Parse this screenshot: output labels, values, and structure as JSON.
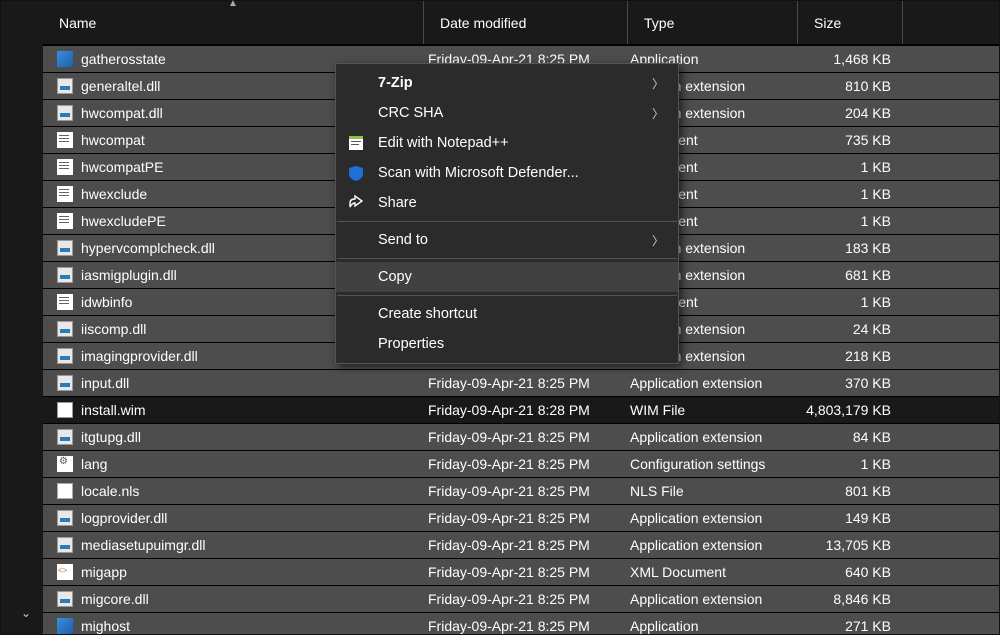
{
  "columns": {
    "name": "Name",
    "date": "Date modified",
    "type": "Type",
    "size": "Size"
  },
  "files": [
    {
      "icon": "app",
      "name": "gatherosstate",
      "date": "Friday-09-Apr-21 8:25 PM",
      "type": "Application",
      "size": "1,468 KB",
      "sel": true
    },
    {
      "icon": "dll",
      "name": "generaltel.dll",
      "date": "",
      "type": "…cation extension",
      "size": "810 KB",
      "sel": true
    },
    {
      "icon": "dll",
      "name": "hwcompat.dll",
      "date": "",
      "type": "…cation extension",
      "size": "204 KB",
      "sel": true
    },
    {
      "icon": "txt",
      "name": "hwcompat",
      "date": "",
      "type": "…ocument",
      "size": "735 KB",
      "sel": true
    },
    {
      "icon": "txt",
      "name": "hwcompatPE",
      "date": "",
      "type": "…ocument",
      "size": "1 KB",
      "sel": true
    },
    {
      "icon": "txt",
      "name": "hwexclude",
      "date": "",
      "type": "…ocument",
      "size": "1 KB",
      "sel": true
    },
    {
      "icon": "txt",
      "name": "hwexcludePE",
      "date": "",
      "type": "…ocument",
      "size": "1 KB",
      "sel": true
    },
    {
      "icon": "dll",
      "name": "hypervcomplcheck.dll",
      "date": "",
      "type": "…cation extension",
      "size": "183 KB",
      "sel": true
    },
    {
      "icon": "dll",
      "name": "iasmigplugin.dll",
      "date": "",
      "type": "…cation extension",
      "size": "681 KB",
      "sel": true
    },
    {
      "icon": "txt",
      "name": "idwbinfo",
      "date": "",
      "type": "…ocument",
      "size": "1 KB",
      "sel": true
    },
    {
      "icon": "dll",
      "name": "iiscomp.dll",
      "date": "",
      "type": "…cation extension",
      "size": "24 KB",
      "sel": true
    },
    {
      "icon": "dll",
      "name": "imagingprovider.dll",
      "date": "",
      "type": "…cation extension",
      "size": "218 KB",
      "sel": true
    },
    {
      "icon": "dll",
      "name": "input.dll",
      "date": "Friday-09-Apr-21 8:25 PM",
      "type": "Application extension",
      "size": "370 KB",
      "sel": true
    },
    {
      "icon": "wim",
      "name": "install.wim",
      "date": "Friday-09-Apr-21 8:28 PM",
      "type": "WIM File",
      "size": "4,803,179 KB",
      "sel": false
    },
    {
      "icon": "dll",
      "name": "itgtupg.dll",
      "date": "Friday-09-Apr-21 8:25 PM",
      "type": "Application extension",
      "size": "84 KB",
      "sel": true
    },
    {
      "icon": "cfg",
      "name": "lang",
      "date": "Friday-09-Apr-21 8:25 PM",
      "type": "Configuration settings",
      "size": "1 KB",
      "sel": true
    },
    {
      "icon": "nls",
      "name": "locale.nls",
      "date": "Friday-09-Apr-21 8:25 PM",
      "type": "NLS File",
      "size": "801 KB",
      "sel": true
    },
    {
      "icon": "dll",
      "name": "logprovider.dll",
      "date": "Friday-09-Apr-21 8:25 PM",
      "type": "Application extension",
      "size": "149 KB",
      "sel": true
    },
    {
      "icon": "dll",
      "name": "mediasetupuimgr.dll",
      "date": "Friday-09-Apr-21 8:25 PM",
      "type": "Application extension",
      "size": "13,705 KB",
      "sel": true
    },
    {
      "icon": "xml",
      "name": "migapp",
      "date": "Friday-09-Apr-21 8:25 PM",
      "type": "XML Document",
      "size": "640 KB",
      "sel": true
    },
    {
      "icon": "dll",
      "name": "migcore.dll",
      "date": "Friday-09-Apr-21 8:25 PM",
      "type": "Application extension",
      "size": "8,846 KB",
      "sel": true
    },
    {
      "icon": "app",
      "name": "mighost",
      "date": "Friday-09-Apr-21 8:25 PM",
      "type": "Application",
      "size": "271 KB",
      "sel": true
    }
  ],
  "menu": {
    "sevenzip": "7-Zip",
    "crc": "CRC SHA",
    "notepad": "Edit with Notepad++",
    "defender": "Scan with Microsoft Defender...",
    "share": "Share",
    "sendto": "Send to",
    "copy": "Copy",
    "shortcut": "Create shortcut",
    "properties": "Properties"
  }
}
